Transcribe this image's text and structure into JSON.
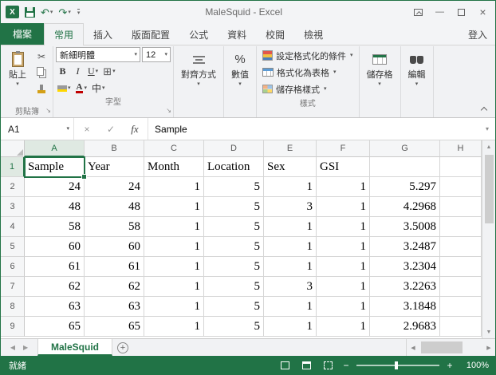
{
  "titlebar": {
    "title": "MaleSquid - Excel",
    "logo_letter": "X"
  },
  "ribbon_tabs": {
    "file": "檔案",
    "home": "常用",
    "insert": "插入",
    "page_layout": "版面配置",
    "formulas": "公式",
    "data": "資料",
    "review": "校閱",
    "view": "檢視",
    "sign_in": "登入"
  },
  "ribbon": {
    "paste": "貼上",
    "clipboard_group": "剪貼簿",
    "font_name": "新細明體",
    "font_size": "12",
    "bold": "B",
    "italic": "I",
    "underline": "U",
    "font_color_letter": "A",
    "phonetic": "中",
    "font_group": "字型",
    "alignment": "對齊方式",
    "number": "數值",
    "percent": "%",
    "conditional_formatting": "設定格式化的條件",
    "format_as_table": "格式化為表格",
    "cell_styles": "儲存格樣式",
    "styles_group": "樣式",
    "cells": "儲存格",
    "editing": "編輯"
  },
  "formula_bar": {
    "name_box": "A1",
    "cancel": "×",
    "enter": "✓",
    "fx": "fx",
    "content": "Sample"
  },
  "grid": {
    "selected_cell": "A1",
    "columns": [
      "A",
      "B",
      "C",
      "D",
      "E",
      "F",
      "G",
      "H"
    ],
    "rows": [
      {
        "n": 1,
        "cells": [
          "Sample",
          "Year",
          "Month",
          "Location",
          "Sex",
          "GSI",
          "",
          ""
        ]
      },
      {
        "n": 2,
        "cells": [
          "24",
          "24",
          "1",
          "5",
          "1",
          "1",
          "5.297",
          ""
        ]
      },
      {
        "n": 3,
        "cells": [
          "48",
          "48",
          "1",
          "5",
          "3",
          "1",
          "4.2968",
          ""
        ]
      },
      {
        "n": 4,
        "cells": [
          "58",
          "58",
          "1",
          "5",
          "1",
          "1",
          "3.5008",
          ""
        ]
      },
      {
        "n": 5,
        "cells": [
          "60",
          "60",
          "1",
          "5",
          "1",
          "1",
          "3.2487",
          ""
        ]
      },
      {
        "n": 6,
        "cells": [
          "61",
          "61",
          "1",
          "5",
          "1",
          "1",
          "3.2304",
          ""
        ]
      },
      {
        "n": 7,
        "cells": [
          "62",
          "62",
          "1",
          "5",
          "3",
          "1",
          "3.2263",
          ""
        ]
      },
      {
        "n": 8,
        "cells": [
          "63",
          "63",
          "1",
          "5",
          "1",
          "1",
          "3.1848",
          ""
        ]
      },
      {
        "n": 9,
        "cells": [
          "65",
          "65",
          "1",
          "5",
          "1",
          "1",
          "2.9683",
          ""
        ]
      }
    ]
  },
  "sheet_bar": {
    "tab": "MaleSquid"
  },
  "status_bar": {
    "ready": "就緒",
    "zoom": "100%"
  },
  "colors": {
    "excel_green": "#217346"
  },
  "icons": {
    "dropdown": "▾",
    "undo": "↶",
    "redo": "↷",
    "minimize": "—",
    "close": "×",
    "scissors": "✂",
    "borders_grid": "⊞",
    "launcher": "↘",
    "scroll_up": "▲",
    "scroll_down": "▼",
    "scroll_left": "◀",
    "scroll_right": "▶",
    "new_sheet": "+",
    "zoom_minus": "−",
    "zoom_plus": "+"
  }
}
